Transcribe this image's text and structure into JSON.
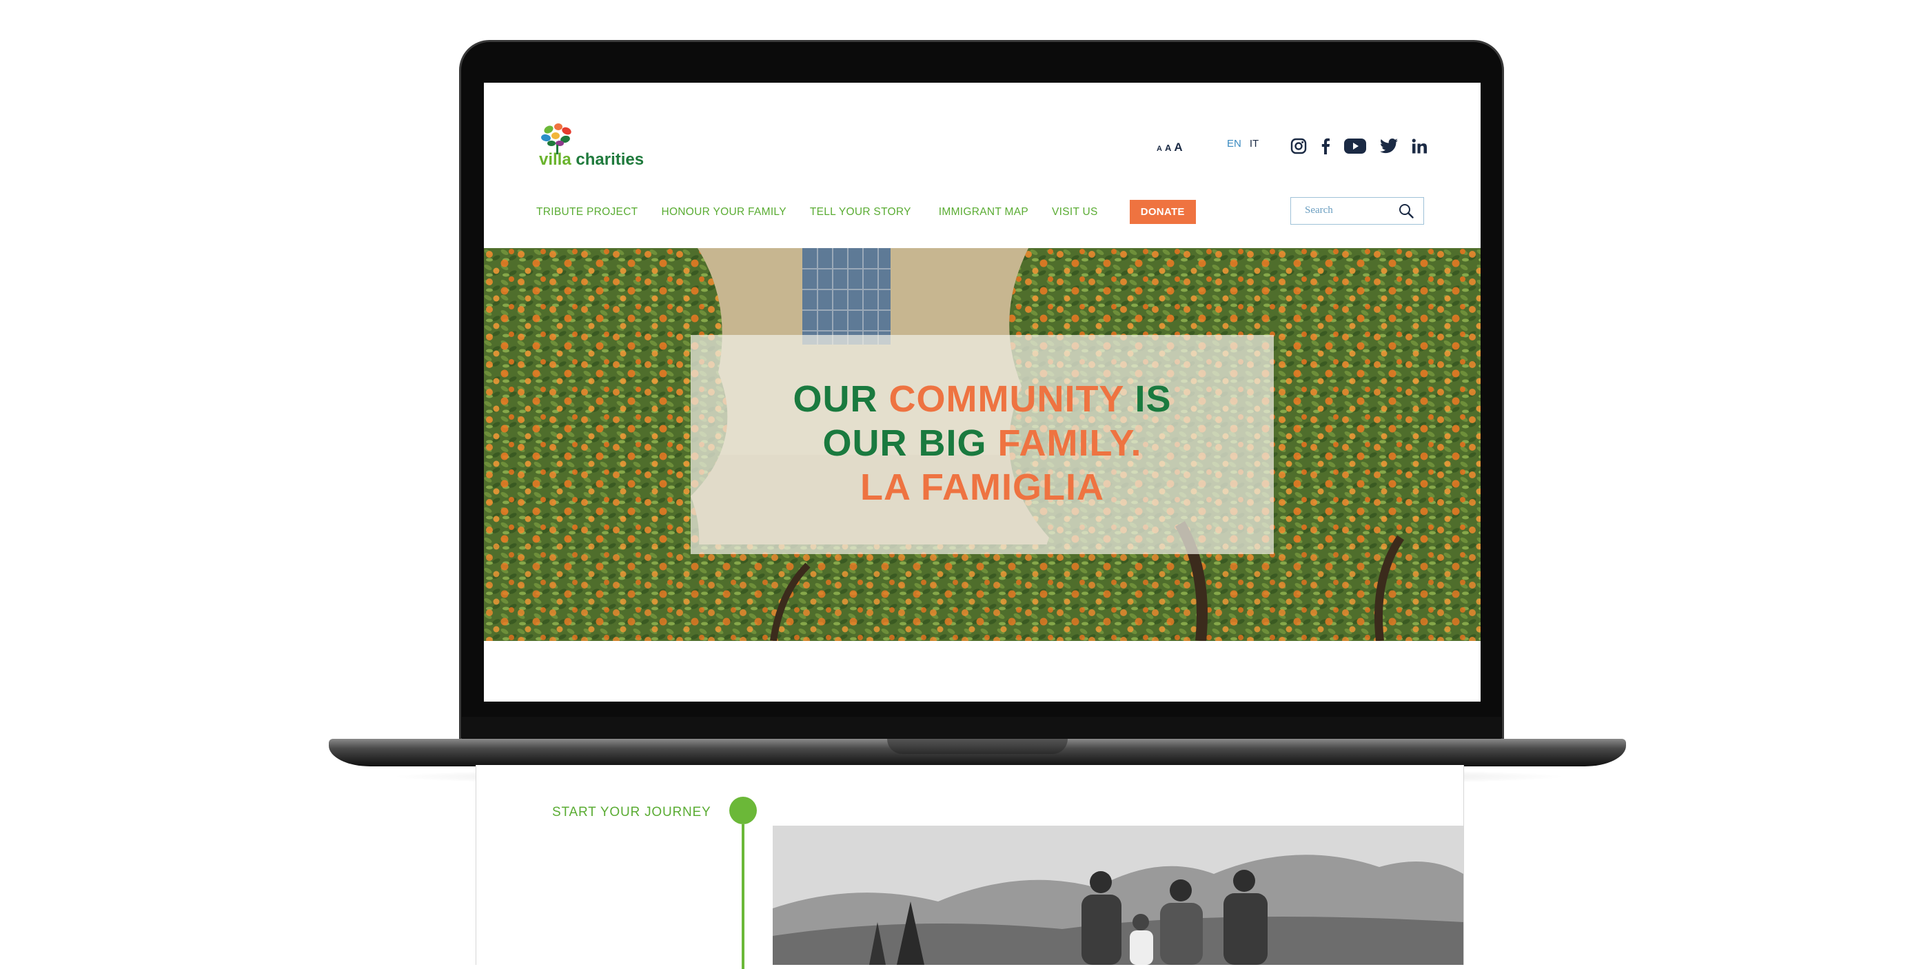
{
  "brand": {
    "name_prefix": "vi",
    "name_mid": "lla",
    "name_suffix": " charities"
  },
  "font_size_control": {
    "small": "A",
    "medium": "A",
    "large": "A"
  },
  "language": {
    "en": "EN",
    "it": "IT"
  },
  "social_icons": [
    "instagram-icon",
    "facebook-icon",
    "youtube-icon",
    "twitter-icon",
    "linkedin-icon"
  ],
  "nav": {
    "items": [
      "TRIBUTE PROJECT",
      "HONOUR YOUR FAMILY",
      "TELL YOUR STORY",
      "IMMIGRANT MAP",
      "VISIT US"
    ],
    "donate": "DONATE"
  },
  "search": {
    "placeholder": "Search"
  },
  "hero": {
    "line1": {
      "a": "OUR ",
      "b": "COMMUNITY",
      "c": " IS"
    },
    "line2": {
      "a": "OUR BIG ",
      "b": "FAMILY."
    },
    "line3": "LA FAMIGLIA"
  },
  "journey": {
    "label": "START YOUR JOURNEY"
  },
  "colors": {
    "green": "#1a7a3f",
    "light_green": "#5aac33",
    "orange": "#ee7341",
    "navy": "#1b2a44"
  }
}
